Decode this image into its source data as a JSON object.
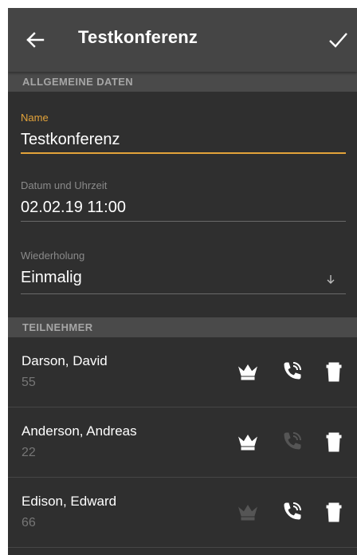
{
  "appbar": {
    "title": "Testkonferenz",
    "back_icon": "arrow-left-icon",
    "confirm_icon": "check-icon"
  },
  "general": {
    "header": "ALLGEMEINE DATEN",
    "name_label": "Name",
    "name_value": "Testkonferenz",
    "datetime_label": "Datum und Uhrzeit",
    "datetime_value": "02.02.19 11:00",
    "repeat_label": "Wiederholung",
    "repeat_value": "Einmalig"
  },
  "participants": {
    "header": "TEILNEHMER",
    "rows": [
      {
        "name": "Darson, David",
        "number": "55",
        "moderator": false,
        "dial": true
      },
      {
        "name": "Anderson, Andreas",
        "number": "22",
        "moderator": false,
        "dial": false
      },
      {
        "name": "Edison, Edward",
        "number": "66",
        "moderator": true,
        "dial": true
      }
    ]
  },
  "colors": {
    "accent": "#e3a33a",
    "appbar": "#454545",
    "background": "#2f2f2f",
    "icon_active": "#ffffff",
    "icon_dimmed": "#555555"
  }
}
